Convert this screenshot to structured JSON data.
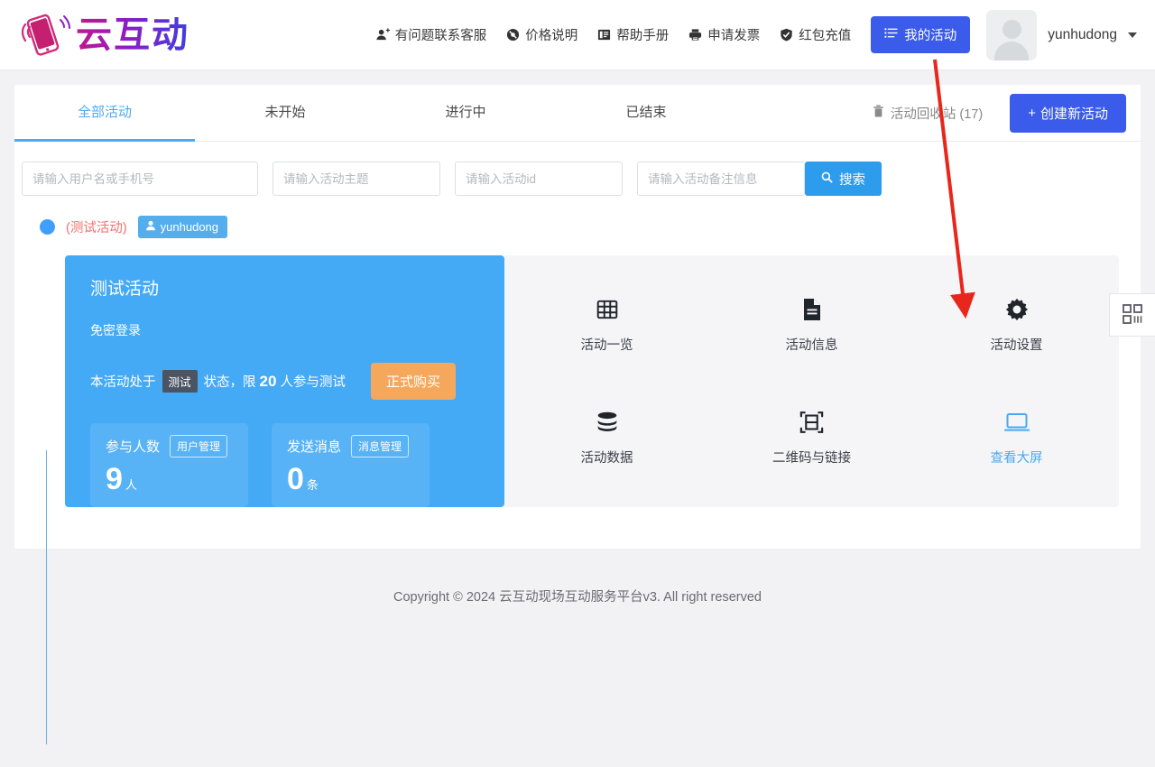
{
  "brand": {
    "name": "云互动",
    "accent": "#3b5beb"
  },
  "header": {
    "nav": [
      {
        "label": "有问题联系客服",
        "icon": "contact-support-icon"
      },
      {
        "label": "价格说明",
        "icon": "price-tag-icon"
      },
      {
        "label": "帮助手册",
        "icon": "book-icon"
      },
      {
        "label": "申请发票",
        "icon": "printer-icon"
      },
      {
        "label": "红包充值",
        "icon": "shield-check-icon"
      }
    ],
    "my_activities_label": "我的活动",
    "my_activities_icon": "list-icon",
    "user_name": "yunhudong",
    "avatar_icon": "avatar-placeholder-icon",
    "caret_icon": "chevron-down-icon"
  },
  "tabs": [
    {
      "label": "全部活动",
      "active": true
    },
    {
      "label": "未开始",
      "active": false
    },
    {
      "label": "进行中",
      "active": false
    },
    {
      "label": "已结束",
      "active": false
    }
  ],
  "toolbar": {
    "recycle_label": "活动回收站 (17)",
    "recycle_icon": "trash-icon",
    "create_label": "创建新活动",
    "create_icon": "plus-icon"
  },
  "search": {
    "user_placeholder": "请输入用户名或手机号",
    "topic_placeholder": "请输入活动主题",
    "id_placeholder": "请输入活动id",
    "note_placeholder": "请输入活动备注信息",
    "user_value": "",
    "topic_value": "",
    "id_value": "",
    "note_value": "",
    "button_label": "搜索",
    "button_icon": "search-icon"
  },
  "activity": {
    "flag_label": "(测试活动)",
    "owner_badge": "yunhudong",
    "owner_icon": "user-icon",
    "name": "测试活动",
    "sub": "免密登录",
    "status_prefix": "本活动处于",
    "status_tag": "测试",
    "status_middle": "状态，限",
    "status_limit": "20",
    "status_suffix": "人参与测试",
    "buy_label": "正式购买",
    "stats": [
      {
        "label": "参与人数",
        "chip": "用户管理",
        "value": "9",
        "unit": "人"
      },
      {
        "label": "发送消息",
        "chip": "消息管理",
        "value": "0",
        "unit": "条"
      }
    ],
    "tiles": [
      {
        "label": "活动一览",
        "icon": "grid-icon",
        "link": false
      },
      {
        "label": "活动信息",
        "icon": "document-icon",
        "link": false
      },
      {
        "label": "活动设置",
        "icon": "gear-icon",
        "link": false
      },
      {
        "label": "活动数据",
        "icon": "database-icon",
        "link": false
      },
      {
        "label": "二维码与链接",
        "icon": "qrcode-scan-icon",
        "link": false
      },
      {
        "label": "查看大屏",
        "icon": "monitor-icon",
        "link": true
      }
    ]
  },
  "side_tab": {
    "icon": "qrcode-icon"
  },
  "footer": {
    "text": "Copyright © 2024 云互动现场互动服务平台v3. All right reserved"
  },
  "annotation": {
    "color": "#e8271c",
    "from": [
      1036,
      66
    ],
    "to": [
      1070,
      342
    ],
    "points_at": "活动设置"
  }
}
